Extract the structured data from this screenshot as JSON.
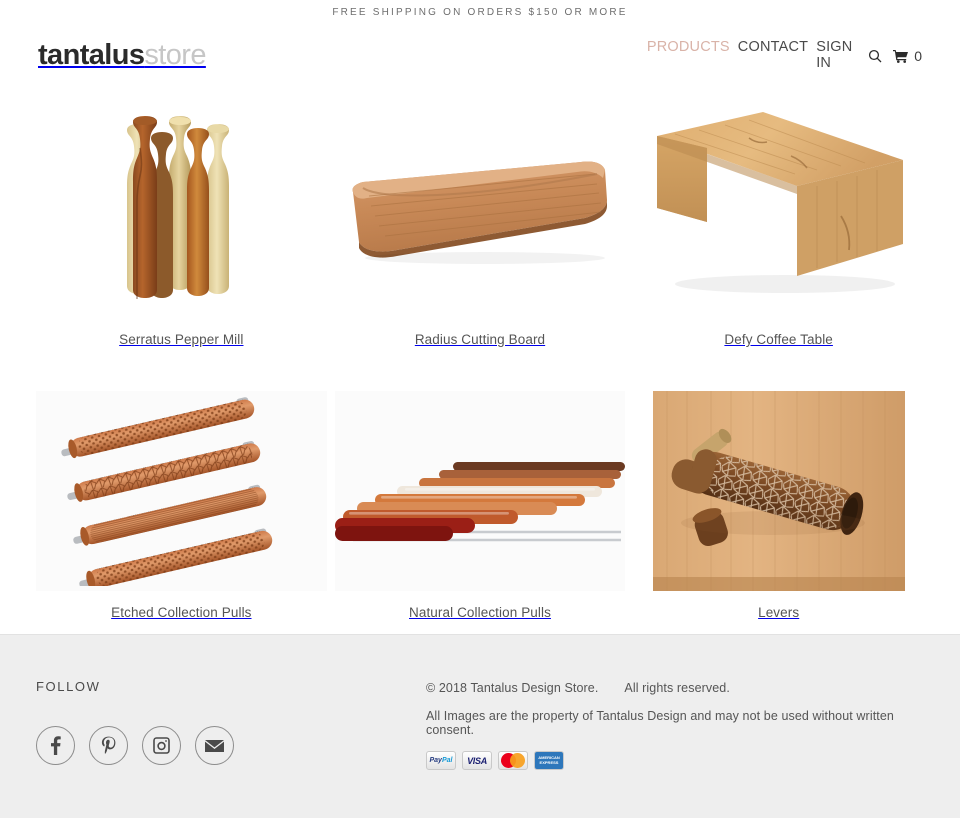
{
  "announcement": {
    "text": "FREE SHIPPING ON ORDERS $150 OR MORE"
  },
  "header": {
    "logo_bold": "tantalus",
    "logo_light": "store",
    "nav": [
      {
        "label": "PRODUCTS",
        "active": true
      },
      {
        "label": "CONTACT",
        "active": false
      },
      {
        "label": "SIGN IN",
        "active": false
      }
    ],
    "search_icon": "search-icon",
    "cart_icon": "cart-icon",
    "cart_count": "0"
  },
  "products": [
    {
      "title": "Serratus Pepper Mill",
      "image": "wooden-pepper-mills"
    },
    {
      "title": "Radius Cutting Board",
      "image": "wooden-cutting-board"
    },
    {
      "title": "Defy Coffee Table",
      "image": "wooden-waterfall-bench"
    },
    {
      "title": "Etched Collection Pulls",
      "image": "etched-cylinder-pulls"
    },
    {
      "title": "Natural Collection Pulls",
      "image": "wooden-bar-pulls-row"
    },
    {
      "title": "Levers",
      "image": "etched-door-lever"
    }
  ],
  "footer": {
    "follow_title": "FOLLOW",
    "socials": [
      {
        "name": "facebook-icon",
        "glyph": "f"
      },
      {
        "name": "pinterest-icon",
        "glyph": "P"
      },
      {
        "name": "instagram-icon",
        "glyph": "camera"
      },
      {
        "name": "email-icon",
        "glyph": "envelope"
      }
    ],
    "copyright": "© 2018 Tantalus Design Store.",
    "rights": "All rights reserved.",
    "disclaimer": "All Images are the property of Tantalus Design and may not be used without written consent.",
    "payments": [
      {
        "name": "paypal-badge",
        "label": "PayPal"
      },
      {
        "name": "visa-badge",
        "label": "VISA"
      },
      {
        "name": "mastercard-badge",
        "label": "Mastercard"
      },
      {
        "name": "amex-badge",
        "label": "AMERICAN EXPRESS"
      }
    ]
  },
  "colors": {
    "accent": "#d9b3a8",
    "text": "#3d3d3d",
    "muted": "#6e6e6e",
    "footer_bg": "#eeeeee"
  }
}
